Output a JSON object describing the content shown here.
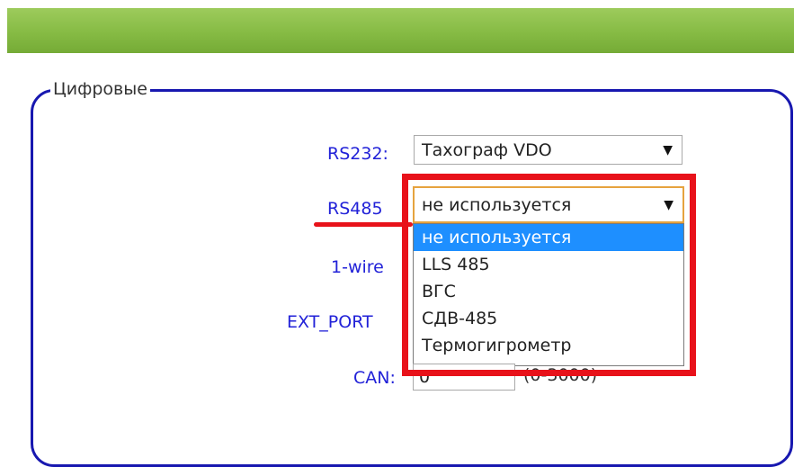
{
  "fieldset": {
    "legend": "Цифровые"
  },
  "fields": {
    "rs232": {
      "label": "RS232:",
      "value": "Тахограф VDO"
    },
    "rs485": {
      "label": "RS485",
      "value": "не используется"
    },
    "one_wire": {
      "label": "1-wire"
    },
    "ext_port": {
      "label": "EXT_PORT"
    },
    "can": {
      "label": "CAN:",
      "value": "0",
      "hint": "(0-3000)"
    }
  },
  "rs485_dropdown": {
    "options": [
      "не используется",
      "LLS 485",
      "ВГС",
      "СДВ-485",
      "Термогигрометр"
    ],
    "selected_index": 0
  },
  "colors": {
    "header_green": "#86bb44",
    "fieldset_border": "#1818b0",
    "label_blue": "#2222d8",
    "highlight_red": "#e8121a",
    "selection_blue": "#1e8fff"
  }
}
